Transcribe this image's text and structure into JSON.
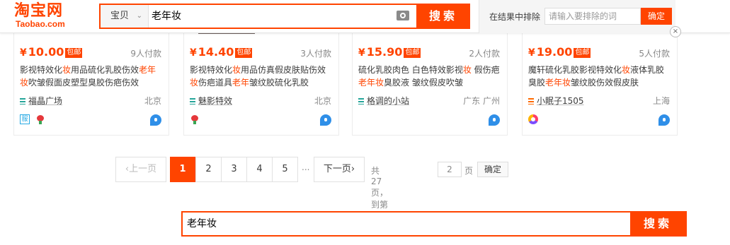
{
  "header": {
    "logo_cn": "淘宝网",
    "logo_en": "Taobao.com",
    "scope": "宝贝",
    "query": "老年妆",
    "search_button": "搜索",
    "exclude_label": "在结果中排除",
    "exclude_placeholder": "请输入要排除的词",
    "exclude_button": "确定",
    "close": "×"
  },
  "products": [
    {
      "price": "10.00",
      "baoyou": "包邮",
      "buyers": "9人付款",
      "title_parts": [
        {
          "t": "影视特效化",
          "hl": false
        },
        {
          "t": "妆",
          "hl": true
        },
        {
          "t": "用品硫化乳胶伤效",
          "hl": false
        },
        {
          "t": "老年",
          "hl": true
        },
        {
          "t": "妆",
          "hl": true
        },
        {
          "t": "吹皱假面皮塑型臭胶伤疤伤效",
          "hl": false
        }
      ],
      "shop": "福晶广场",
      "location": "北京",
      "badges": [
        "square",
        "flower"
      ]
    },
    {
      "price": "14.40",
      "baoyou": "包邮",
      "buyers": "3人付款",
      "title_parts": [
        {
          "t": "影视特效化",
          "hl": false
        },
        {
          "t": "妆",
          "hl": true
        },
        {
          "t": "用品仿真假皮肤贴伤效",
          "hl": false
        },
        {
          "t": "妆",
          "hl": true
        },
        {
          "t": "伤疤道具",
          "hl": false
        },
        {
          "t": "老年",
          "hl": true
        },
        {
          "t": "皱纹胶硫化乳胶",
          "hl": false
        }
      ],
      "shop": "魅影特效",
      "location": "北京",
      "badges": [
        "flower"
      ]
    },
    {
      "price": "15.90",
      "baoyou": "包邮",
      "buyers": "2人付款",
      "title_parts": [
        {
          "t": "硫化乳胶肉色 白色特效影视",
          "hl": false
        },
        {
          "t": "妆",
          "hl": true
        },
        {
          "t": " 假伤疤 ",
          "hl": false
        },
        {
          "t": "老年",
          "hl": true
        },
        {
          "t": "妆",
          "hl": true
        },
        {
          "t": "臭胶液 皱纹假皮吹皱",
          "hl": false
        }
      ],
      "shop": "格调的小站",
      "location": "广东 广州",
      "badges": []
    },
    {
      "price": "19.00",
      "baoyou": "包邮",
      "buyers": "5人付款",
      "title_parts": [
        {
          "t": "魔轩硫化乳胶影视特效化",
          "hl": false
        },
        {
          "t": "妆",
          "hl": true
        },
        {
          "t": "液体乳胶臭胶",
          "hl": false
        },
        {
          "t": "老年",
          "hl": true
        },
        {
          "t": "妆",
          "hl": true
        },
        {
          "t": "皱纹胶伤效假皮肤",
          "hl": false
        }
      ],
      "shop": "小眠子1505",
      "location": "上海",
      "badges": [
        "swirl"
      ]
    }
  ],
  "pagination": {
    "prev": "上一页",
    "pages": [
      "1",
      "2",
      "3",
      "4",
      "5"
    ],
    "current": "1",
    "ellipsis": "...",
    "next": "下一页",
    "total_text": "共 27 页，到第",
    "goto_value": "2",
    "page_unit": "页",
    "confirm": "确定"
  },
  "bottom_search": {
    "query": "老年妆",
    "button": "搜索"
  },
  "colors": {
    "accent": "#ff4400",
    "highlight": "#ff4400",
    "muted": "#888888"
  }
}
